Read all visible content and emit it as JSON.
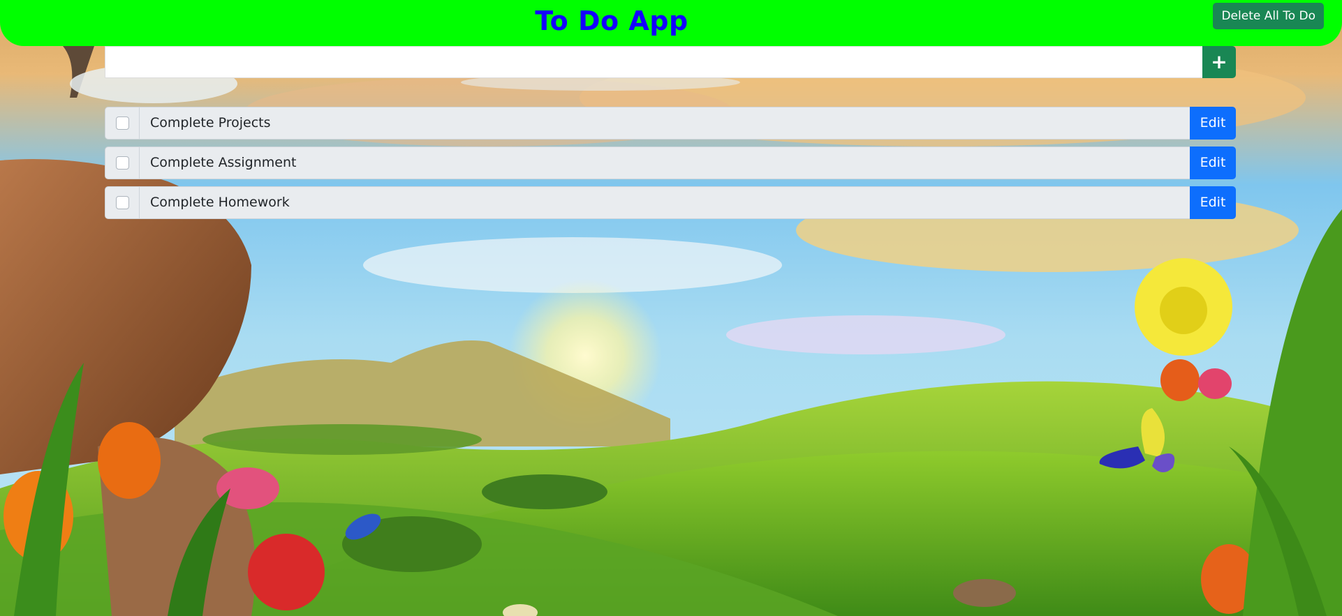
{
  "header": {
    "title": "To Do App",
    "delete_all_label": "Delete All To Do"
  },
  "new_todo": {
    "value": "",
    "placeholder": "",
    "add_icon": "plus-icon"
  },
  "todos": [
    {
      "text": "Complete Projects",
      "checked": false,
      "edit_label": "Edit"
    },
    {
      "text": "Complete Assignment",
      "checked": false,
      "edit_label": "Edit"
    },
    {
      "text": "Complete Homework",
      "checked": false,
      "edit_label": "Edit"
    }
  ],
  "colors": {
    "header_bg": "#00ff00",
    "title": "#1300ff",
    "success": "#198754",
    "primary": "#0d6efd",
    "item_bg": "#e9ecef"
  }
}
